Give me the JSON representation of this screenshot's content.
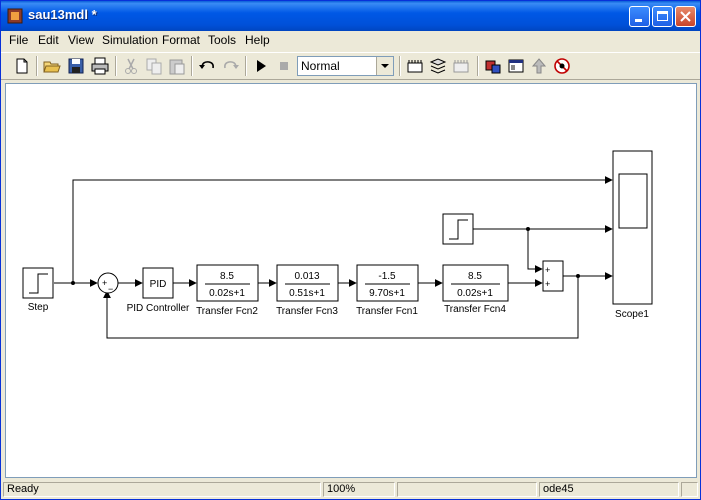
{
  "window": {
    "title": "sau13mdl *"
  },
  "menu": [
    "File",
    "Edit",
    "View",
    "Simulation",
    "Format",
    "Tools",
    "Help"
  ],
  "toolbar": {
    "sim_mode": "Normal"
  },
  "diagram": {
    "step1": "Step",
    "pid_text": "PID",
    "pid_label": "PID Controller",
    "sum_plus": "+",
    "sum_minus": "−",
    "tf2_num": "8.5",
    "tf2_den": "0.02s+1",
    "tf2_label": "Transfer Fcn2",
    "tf3_num": "0.013",
    "tf3_den": "0.51s+1",
    "tf3_label": "Transfer Fcn3",
    "tf1_num": "-1.5",
    "tf1_den": "9.70s+1",
    "tf1_label": "Transfer Fcn1",
    "tf4_num": "8.5",
    "tf4_den": "0.02s+1",
    "tf4_label": "Transfer Fcn4",
    "sum2_p1": "+",
    "sum2_p2": "+",
    "scope_label": "Scope1"
  },
  "status": {
    "left": "Ready",
    "zoom": "100%",
    "solver": "ode45"
  },
  "colors": {
    "titlebar": "#0058e6",
    "chrome": "#ece9d8",
    "canvas": "#ffffff",
    "lines": "#000000"
  }
}
